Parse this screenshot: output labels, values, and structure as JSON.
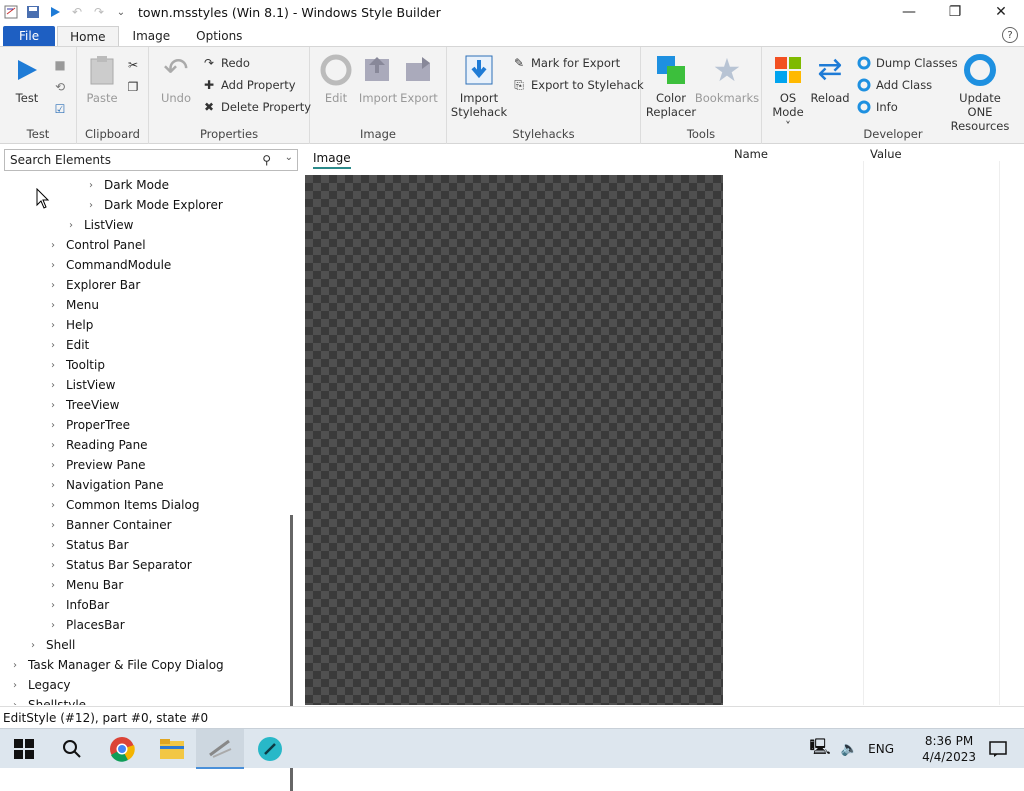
{
  "window": {
    "title": "town.msstyles (Win 8.1) - Windows Style Builder"
  },
  "tabs": [
    "File",
    "Home",
    "Image",
    "Options"
  ],
  "ribbon": {
    "groups": {
      "test": "Test",
      "clipboard": "Clipboard",
      "properties": "Properties",
      "image": "Image",
      "stylehacks": "Stylehacks",
      "tools": "Tools",
      "developer": "Developer"
    },
    "buttons": {
      "test": "Test",
      "paste": "Paste",
      "undo": "Undo",
      "redo": "Redo",
      "add_property": "Add Property",
      "delete_property": "Delete Property",
      "edit": "Edit",
      "import": "Import",
      "export": "Export",
      "import_stylehack_1": "Import",
      "import_stylehack_2": "Stylehack",
      "mark_for_export": "Mark for Export",
      "export_to_stylehack": "Export to Stylehack",
      "color_replacer_1": "Color",
      "color_replacer_2": "Replacer",
      "bookmarks": "Bookmarks",
      "os_mode_1": "OS",
      "os_mode_2": "Mode",
      "reload": "Reload",
      "dump_classes": "Dump Classes",
      "add_class": "Add Class",
      "info": "Info",
      "update_one_1": "Update ONE",
      "update_one_2": "Resources"
    }
  },
  "search": {
    "placeholder": "Search Elements"
  },
  "tree": [
    {
      "label": "Dark Mode",
      "level": 4
    },
    {
      "label": "Dark Mode Explorer",
      "level": 4
    },
    {
      "label": "ListView",
      "level": 3
    },
    {
      "label": "Control Panel",
      "level": 2
    },
    {
      "label": "CommandModule",
      "level": 2
    },
    {
      "label": "Explorer Bar",
      "level": 2
    },
    {
      "label": "Menu",
      "level": 2
    },
    {
      "label": "Help",
      "level": 2
    },
    {
      "label": "Edit",
      "level": 2
    },
    {
      "label": "Tooltip",
      "level": 2
    },
    {
      "label": "ListView",
      "level": 2
    },
    {
      "label": "TreeView",
      "level": 2
    },
    {
      "label": "ProperTree",
      "level": 2
    },
    {
      "label": "Reading Pane",
      "level": 2
    },
    {
      "label": "Preview Pane",
      "level": 2
    },
    {
      "label": "Navigation Pane",
      "level": 2
    },
    {
      "label": "Common Items Dialog",
      "level": 2
    },
    {
      "label": "Banner Container",
      "level": 2
    },
    {
      "label": "Status Bar",
      "level": 2
    },
    {
      "label": "Status Bar Separator",
      "level": 2
    },
    {
      "label": "Menu Bar",
      "level": 2
    },
    {
      "label": "InfoBar",
      "level": 2
    },
    {
      "label": "PlacesBar",
      "level": 2
    },
    {
      "label": "Shell",
      "level": 1
    },
    {
      "label": "Task Manager & File Copy Dialog",
      "level": 0
    },
    {
      "label": "Legacy",
      "level": 0
    },
    {
      "label": "Shellstyle",
      "level": 0
    }
  ],
  "preview": {
    "tab": "Image"
  },
  "props": {
    "name_header": "Name",
    "value_header": "Value"
  },
  "status": "EditStyle (#12), part #0, state #0",
  "taskbar": {
    "lang": "ENG",
    "time": "8:36 PM",
    "date": "4/4/2023"
  }
}
